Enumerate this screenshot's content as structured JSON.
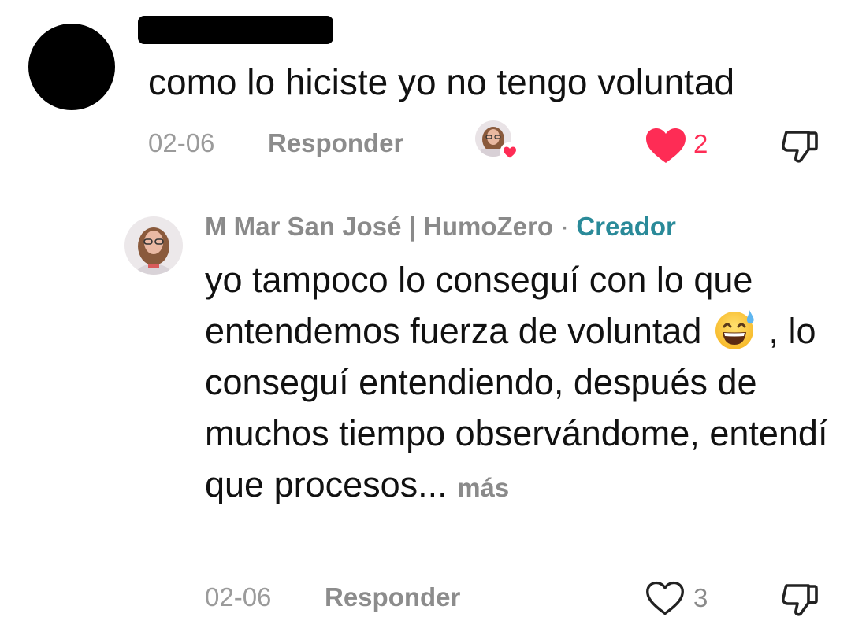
{
  "comment": {
    "text": "como lo hiciste yo no tengo voluntad",
    "date": "02-06",
    "reply_label": "Responder",
    "like_count": "2",
    "liked": true,
    "liked_by_creator": true,
    "icons": {
      "like": "heart-filled-icon",
      "dislike": "thumbs-down-icon"
    },
    "colors": {
      "like": "#fe2c55"
    }
  },
  "reply": {
    "author": "M Mar San José | HumoZero",
    "separator": "·",
    "badge": "Creador",
    "text_part1": "yo tampoco lo conseguí con lo que entendemos fuerza de voluntad",
    "emoji": "grinning-face-with-sweat-emoji",
    "text_part2": ", lo conseguí entendiendo, después de muchos tiempo observándome, entendí que procesos...",
    "more_label": "más",
    "date": "02-06",
    "reply_label": "Responder",
    "like_count": "3",
    "liked": false,
    "icons": {
      "like": "heart-outline-icon",
      "dislike": "thumbs-down-icon"
    },
    "colors": {
      "badge": "#2a8a99"
    }
  }
}
